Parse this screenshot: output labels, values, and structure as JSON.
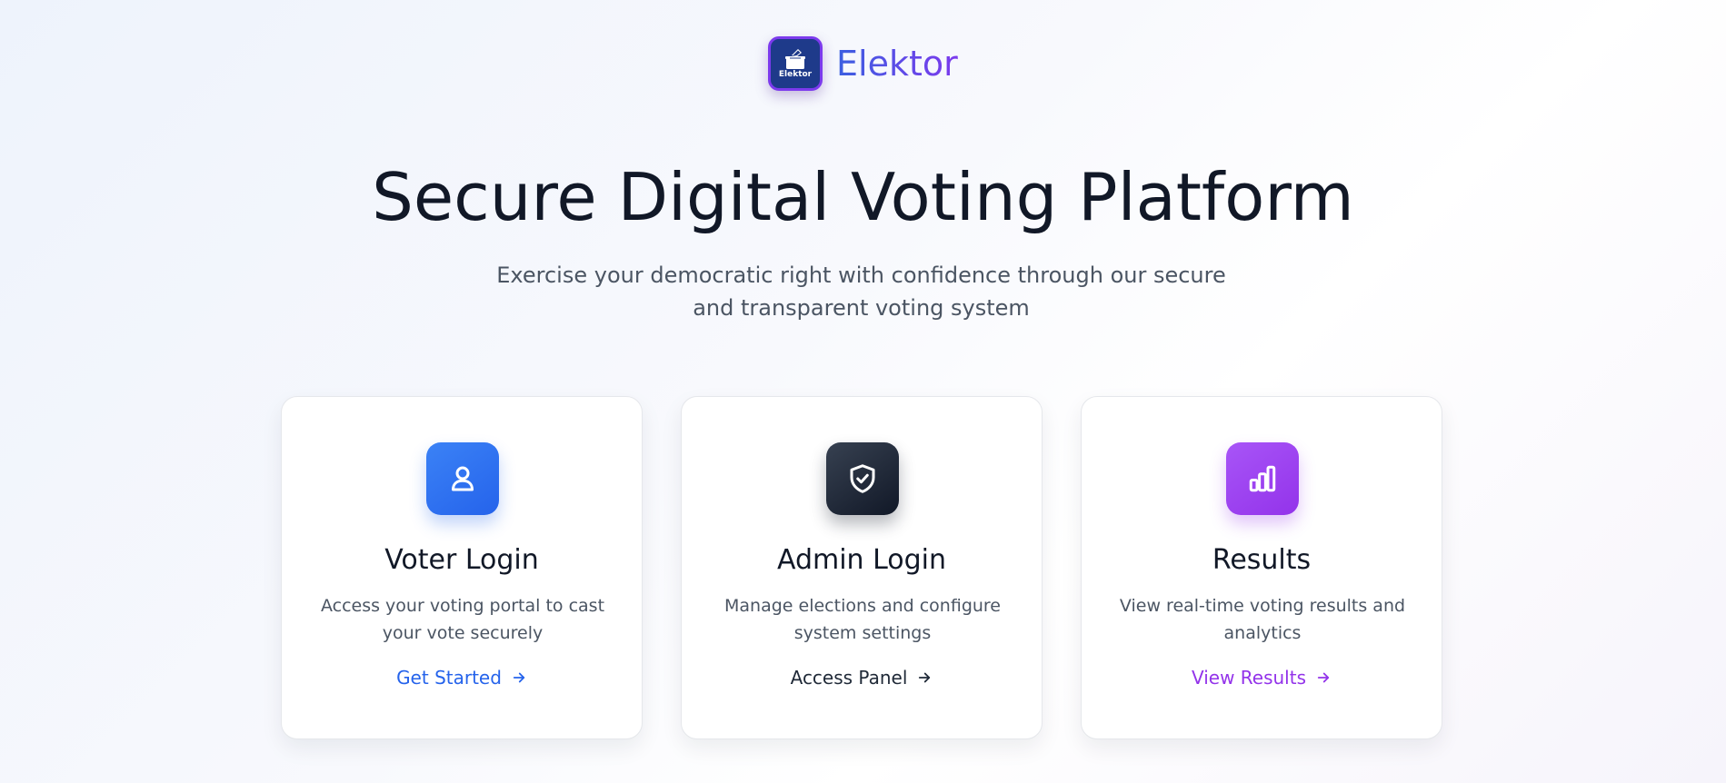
{
  "brand": {
    "logo_text": "Elektor",
    "name": "Elektor",
    "logo_icon": "ballot-box-icon"
  },
  "hero": {
    "title": "Secure Digital Voting Platform",
    "subtitle": "Exercise your democratic right with confidence through our secure and transparent voting system"
  },
  "cards": [
    {
      "icon": "user-icon",
      "title": "Voter Login",
      "description": "Access your voting portal to cast your vote securely",
      "link": "Get Started",
      "accent": "#2563eb"
    },
    {
      "icon": "shield-check-icon",
      "title": "Admin Login",
      "description": "Manage elections and configure system settings",
      "link": "Access Panel",
      "accent": "#1f2937"
    },
    {
      "icon": "bar-chart-icon",
      "title": "Results",
      "description": "View real-time voting results and analytics",
      "link": "View Results",
      "accent": "#9333ea"
    }
  ],
  "colors": {
    "brand_gradient_start": "#3b5fe0",
    "brand_gradient_end": "#7c3aed",
    "title": "#111827",
    "muted_text": "#4b5563"
  }
}
